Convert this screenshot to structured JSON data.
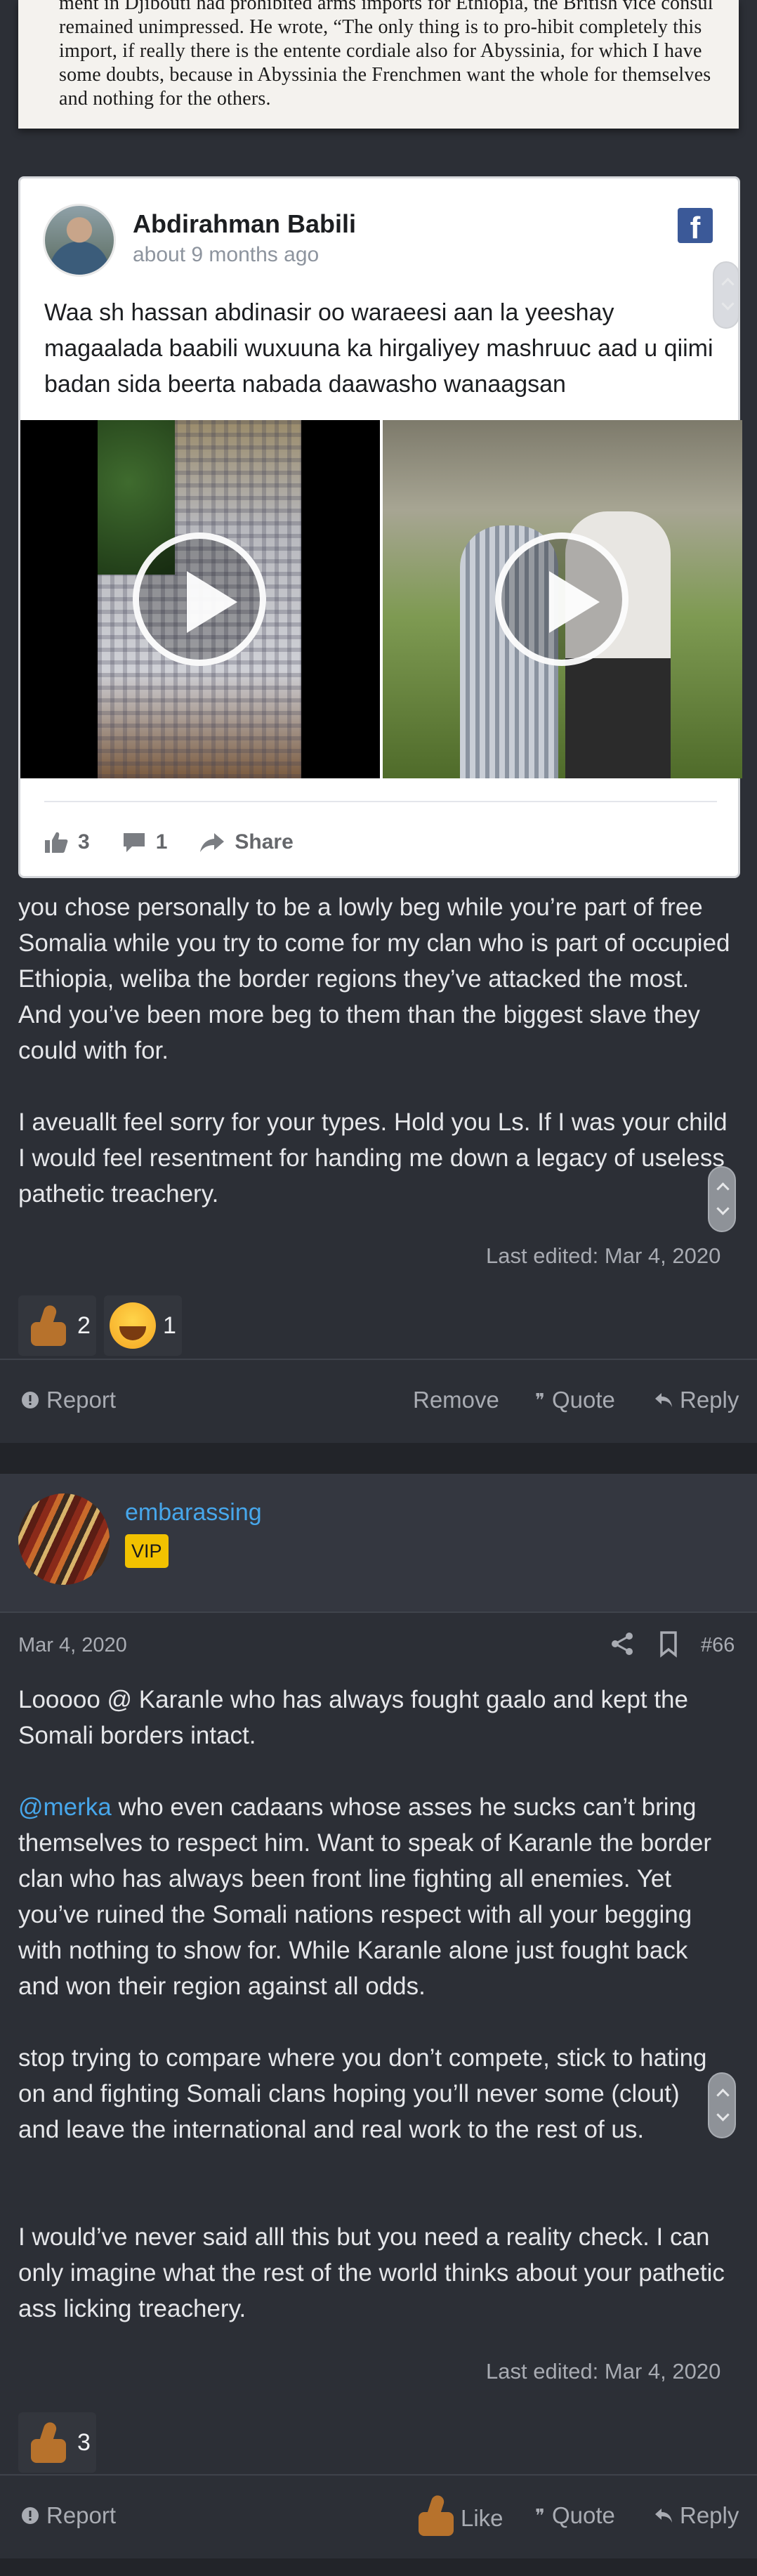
{
  "book_excerpt": {
    "text": "ment in Djibouti had prohibited arms imports for Ethiopia, the British vice consul remained unimpressed. He wrote, “The only thing is to pro-hibit completely this import, if really there is the entente cordiale also for Abyssinia, for which I have some doubts, because in Abyssinia the Frenchmen want the whole for themselves and nothing for the others."
  },
  "facebook_embed": {
    "author": "Abdirahman Babili",
    "timestamp": "about 9 months ago",
    "logo_letter": "f",
    "text": "Waa sh hassan abdinasir oo waraeesi aan la yeeshay magaalada baabili wuxuuna ka hirgaliyey mashruuc aad u qiimi badan sida beerta nabada daawasho wanaagsan",
    "likes": "3",
    "comments": "1",
    "share_label": "Share"
  },
  "post1": {
    "paragraph1": "you chose personally to be a lowly beg while you’re part of free Somalia while you try to come for my clan who is part of occupied Ethiopia, weliba the border regions they’ve attacked the most. And you’ve been more beg to them than the biggest slave they could with for.",
    "paragraph2": "I aveuallt feel sorry for your types. Hold you Ls. If I was your child I would feel resentment for handing me down a legacy of useless pathetic treachery.",
    "last_edited": "Last edited: Mar 4, 2020",
    "reactions": [
      {
        "icon": "like-emoji",
        "count": "2"
      },
      {
        "icon": "laugh-emoji",
        "count": "1"
      }
    ],
    "actions": {
      "report": "Report",
      "remove": "Remove",
      "quote": "Quote",
      "reply": "Reply"
    }
  },
  "post2": {
    "username": "embarassing",
    "badge": "VIP",
    "date": "Mar 4, 2020",
    "post_number": "#66",
    "paragraph1": "Looooo @ Karanle who has always fought gaalo and kept the Somali borders intact.",
    "mention": "@merka",
    "paragraph2_rest": " who even cadaans whose asses he sucks can’t bring themselves to respect him. Want to speak of Karanle the border clan who has always been front line fighting all enemies. Yet you’ve ruined the Somali nations respect with all your begging with nothing to show for. While Karanle alone just fought back and won their region against all odds.",
    "paragraph3": "stop trying to compare where you don’t compete, stick to hating on and fighting Somali clans hoping you’ll never some (clout) and leave the international and real work to the rest of us.",
    "paragraph4": "I would’ve never said alll this but you need a reality check. I can only imagine what the rest of the world thinks about your pathetic ass licking treachery.",
    "last_edited": "Last edited: Mar 4, 2020",
    "reactions": [
      {
        "icon": "like-emoji",
        "count": "3"
      }
    ],
    "actions": {
      "report": "Report",
      "like": "Like",
      "quote": "Quote",
      "reply": "Reply"
    }
  }
}
